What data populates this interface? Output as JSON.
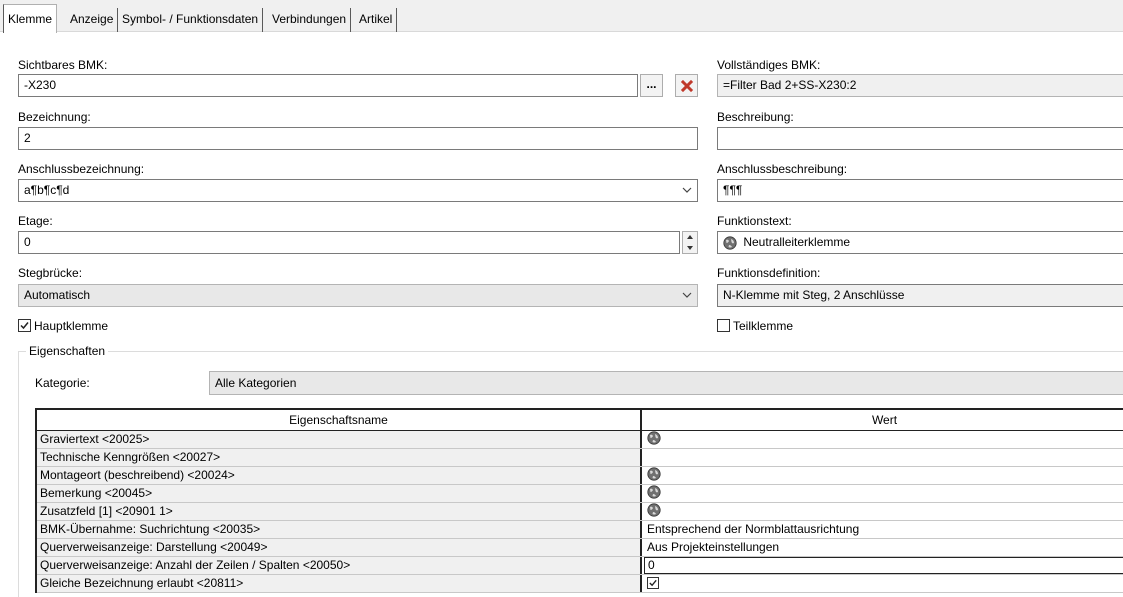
{
  "tabs": [
    {
      "label": "Klemme"
    },
    {
      "label": "Anzeige"
    },
    {
      "label": "Symbol- / Funktionsdaten"
    },
    {
      "label": "Verbindungen"
    },
    {
      "label": "Artikel"
    }
  ],
  "left": {
    "sichtbares_bmk": {
      "label": "Sichtbares BMK:",
      "value": "-X230",
      "browse_label": "..."
    },
    "bezeichnung": {
      "label": "Bezeichnung:",
      "value": "2"
    },
    "anschlussbezeichnung": {
      "label": "Anschlussbezeichnung:",
      "value": "a¶b¶c¶d"
    },
    "etage": {
      "label": "Etage:",
      "value": "0"
    },
    "stegbruecke": {
      "label": "Stegbrücke:",
      "value": "Automatisch"
    },
    "hauptklemme": {
      "label": "Hauptklemme",
      "checked": true
    }
  },
  "right": {
    "vollstaendiges_bmk": {
      "label": "Vollständiges BMK:",
      "value": "=Filter Bad 2+SS-X230:2"
    },
    "beschreibung": {
      "label": "Beschreibung:",
      "value": ""
    },
    "anschlussbeschreibung": {
      "label": "Anschlussbeschreibung:",
      "value": "¶¶¶"
    },
    "funktionstext": {
      "label": "Funktionstext:",
      "value": "Neutralleiterklemme",
      "icon": "globe-icon"
    },
    "funktionsdefinition": {
      "label": "Funktionsdefinition:",
      "value": "N-Klemme mit Steg, 2 Anschlüsse"
    },
    "teilklemme": {
      "label": "Teilklemme",
      "checked": false
    }
  },
  "eigenschaften": {
    "group_label": "Eigenschaften",
    "kategorie_label": "Kategorie:",
    "kategorie_value": "Alle Kategorien",
    "columns": {
      "name": "Eigenschaftsname",
      "value": "Wert"
    },
    "rows": [
      {
        "name": "Graviertext <20025>",
        "value": "",
        "globe": true
      },
      {
        "name": "Technische Kenngrößen <20027>",
        "value": "",
        "globe": false
      },
      {
        "name": "Montageort (beschreibend) <20024>",
        "value": "",
        "globe": true
      },
      {
        "name": "Bemerkung <20045>",
        "value": "",
        "globe": true
      },
      {
        "name": "Zusatzfeld [1] <20901 1>",
        "value": "",
        "globe": true
      },
      {
        "name": "BMK-Übernahme: Suchrichtung <20035>",
        "value": "Entsprechend der Normblattausrichtung",
        "globe": false
      },
      {
        "name": "Querverweisanzeige: Darstellung <20049>",
        "value": "Aus Projekteinstellungen",
        "globe": false
      },
      {
        "name": "Querverweisanzeige: Anzahl der Zeilen / Spalten <20050>",
        "value": "0",
        "globe": false,
        "selected": true
      },
      {
        "name": "Gleiche Bezeichnung erlaubt <20811>",
        "value": "",
        "globe": false,
        "checkbox": true
      }
    ]
  },
  "colors": {
    "accent_red": "#c0392b",
    "tab_bg": "#f0f0f0",
    "cell_gray": "#f0f0f0"
  }
}
